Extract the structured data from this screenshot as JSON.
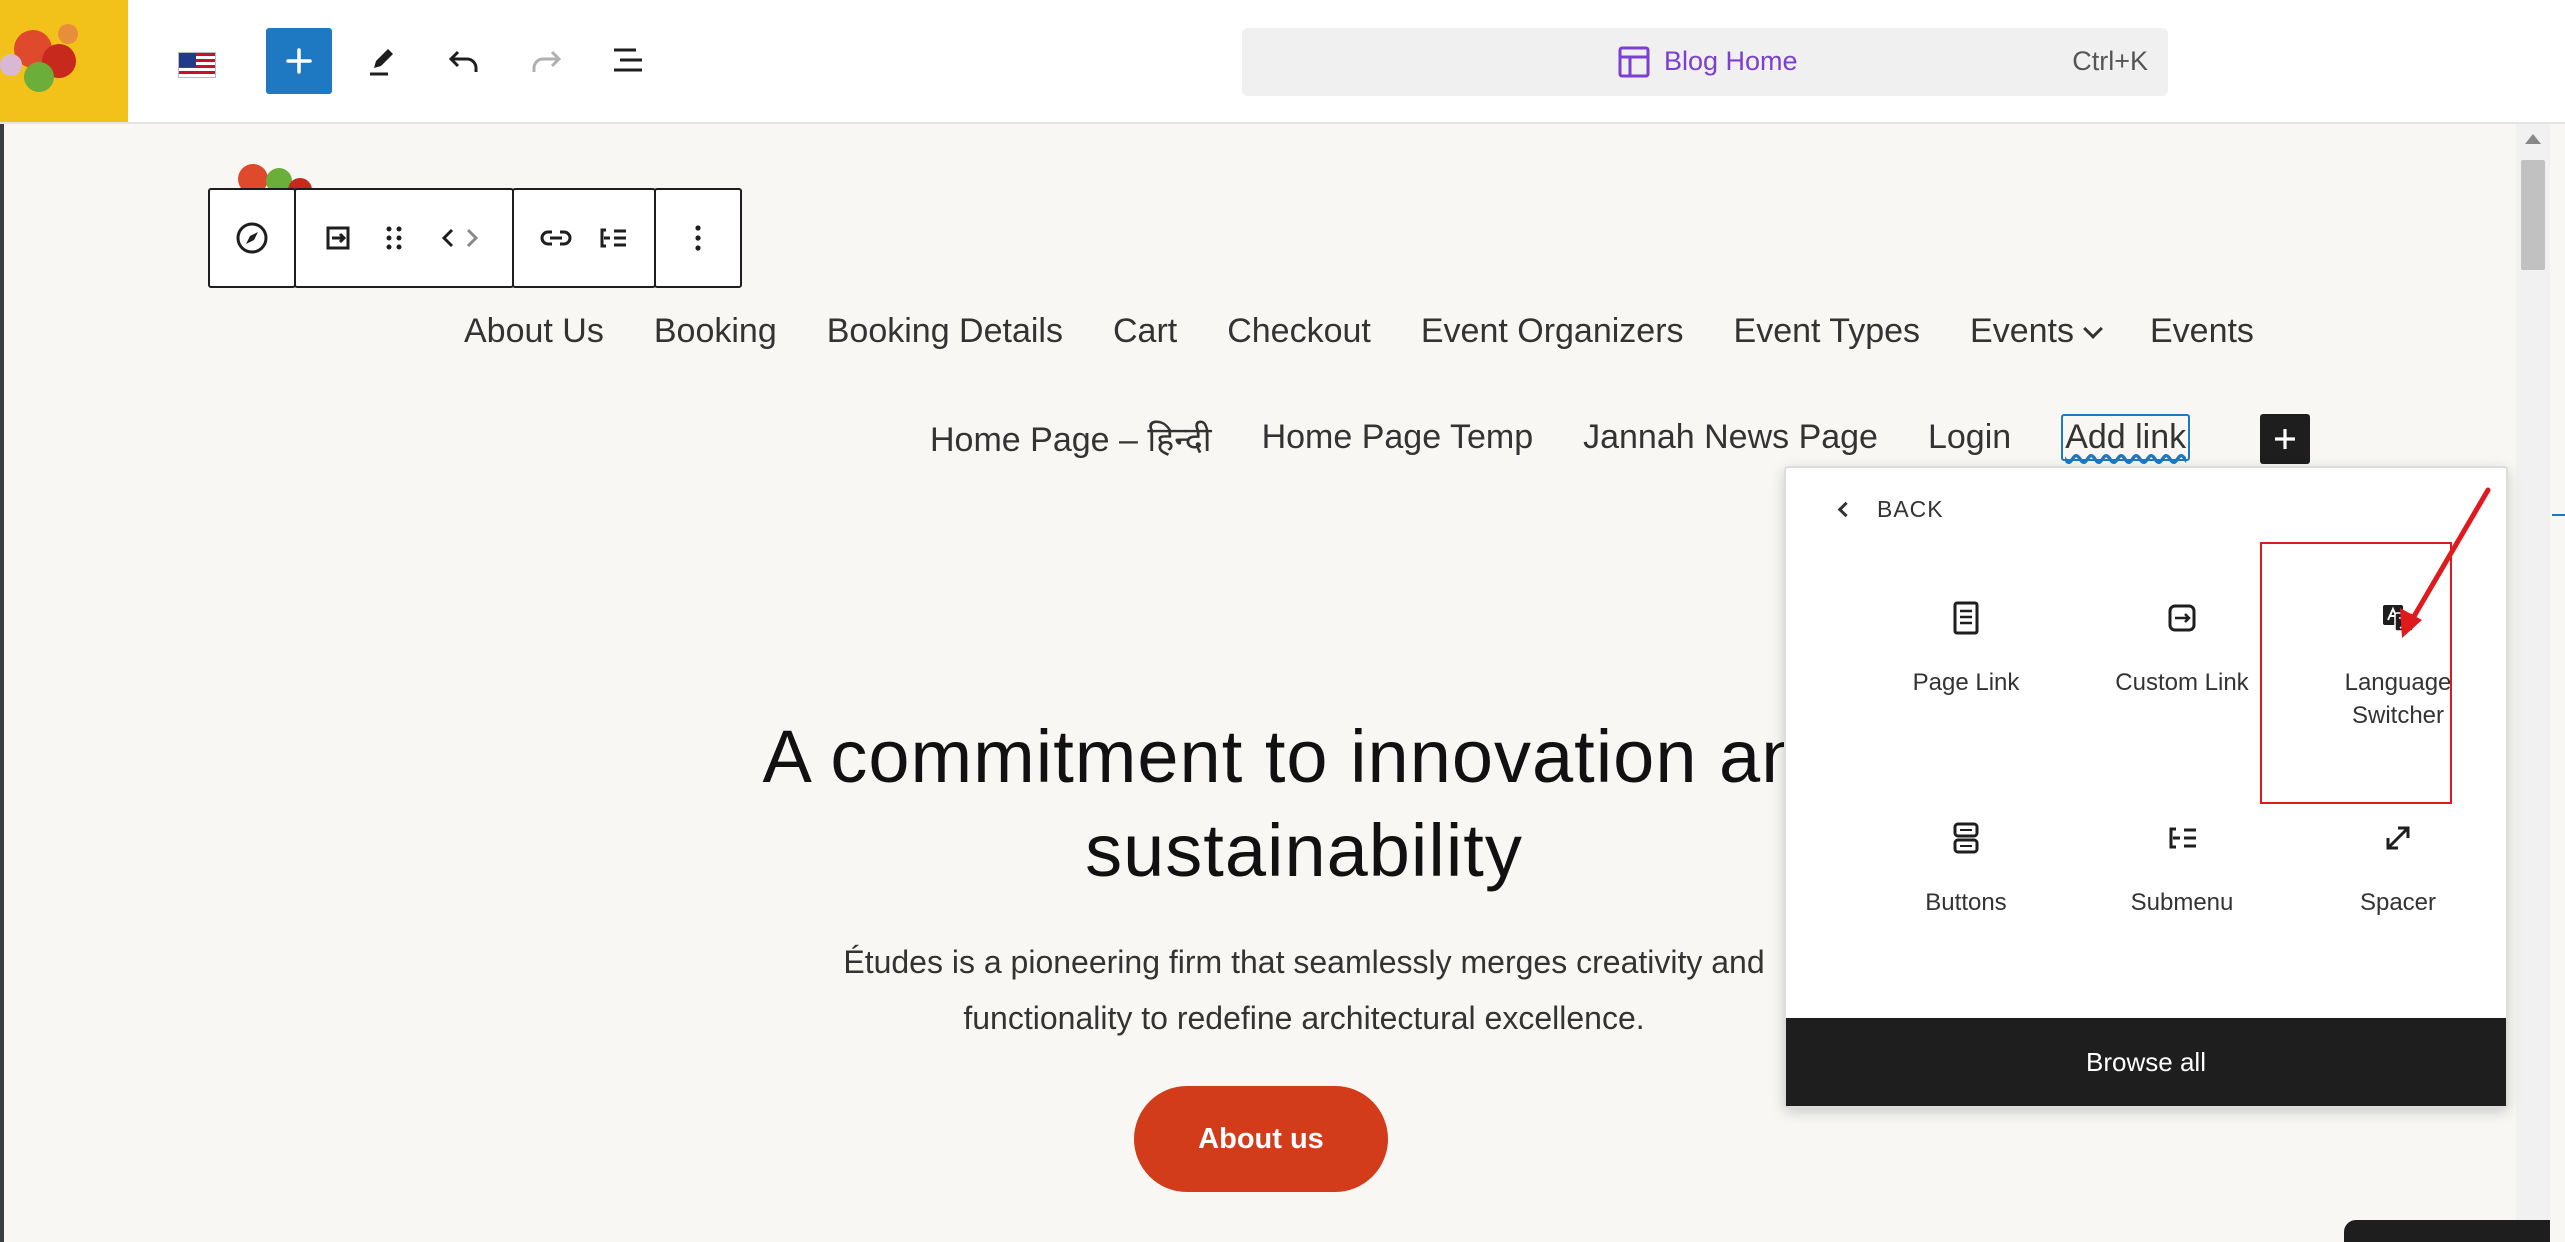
{
  "toolbar": {
    "document_title": "Blog Home",
    "shortcut": "Ctrl+K"
  },
  "navigation": {
    "row1": [
      "About Us",
      "Booking",
      "Booking Details",
      "Cart",
      "Checkout",
      "Event Organizers",
      "Event Types",
      "Events",
      "Events"
    ],
    "row2": [
      "Home Page – हिन्दी",
      "Home Page Temp",
      "Jannah News Page",
      "Login"
    ],
    "add_link_label": "Add link"
  },
  "hero": {
    "title_line1": "A commitment to innovation and",
    "title_line2": "sustainability",
    "text_line1": "Études is a pioneering firm that seamlessly merges creativity and",
    "text_line2": "functionality to redefine architectural excellence.",
    "button_label": "About us"
  },
  "popover": {
    "back_label": "BACK",
    "items": [
      {
        "label": "Page Link",
        "icon": "page-icon"
      },
      {
        "label": "Custom Link",
        "icon": "custom-link-icon"
      },
      {
        "label": "Language\nSwitcher",
        "icon": "translate-icon",
        "highlighted": true
      },
      {
        "label": "Buttons",
        "icon": "buttons-icon"
      },
      {
        "label": "Submenu",
        "icon": "submenu-icon"
      },
      {
        "label": "Spacer",
        "icon": "spacer-icon"
      }
    ],
    "footer_label": "Browse all"
  },
  "colors": {
    "accent_blue": "#1e78c2",
    "document_title": "#7b3fd1",
    "hero_button": "#d23c1a",
    "highlight": "#e0191d",
    "canvas_bg": "#f8f7f4"
  }
}
